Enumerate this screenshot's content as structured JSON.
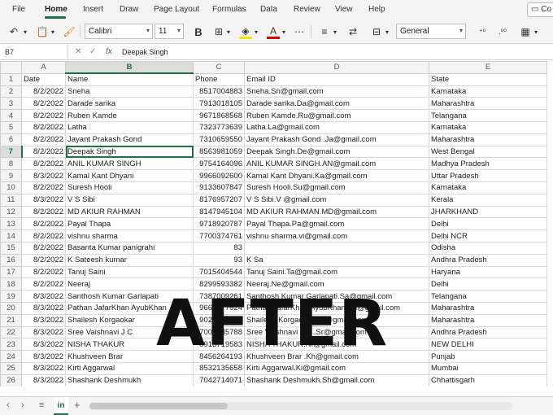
{
  "menu": {
    "tabs": [
      "File",
      "Home",
      "Insert",
      "Draw",
      "Page Layout",
      "Formulas",
      "Data",
      "Review",
      "View",
      "Help"
    ],
    "active": "Home",
    "comments_label": "Co"
  },
  "ribbon": {
    "font_name": "Calibri",
    "font_size": "11",
    "number_format": "General",
    "bold_label": "B",
    "font_color_label": "A"
  },
  "formula_bar": {
    "name_box": "B7",
    "fx_label": "fx",
    "content": "Deepak Singh"
  },
  "sheet": {
    "columns": [
      "A",
      "B",
      "C",
      "D",
      "E"
    ],
    "selected_column": "B",
    "selected_row": 7,
    "headers": [
      "Date",
      "Name",
      "Phone",
      "Email ID",
      "State"
    ],
    "rows": [
      [
        "8/2/2022",
        "Sneha",
        "8517004883",
        "Sneha.Sn@gmail.com",
        "Karnataka"
      ],
      [
        "8/2/2022",
        "Darade sarika",
        "7913018105",
        "Darade sarika.Da@gmail.com",
        "Maharashtra"
      ],
      [
        "8/2/2022",
        "Ruben Kamde",
        "9671868568",
        "Ruben Kamde.Ru@gmail.com",
        "Telangana"
      ],
      [
        "8/2/2022",
        "Latha",
        "7323773639",
        "Latha.La@gmail.com",
        "Karnataka"
      ],
      [
        "8/2/2022",
        "Jayant Prakash Gond",
        "7310659550",
        "Jayant Prakash Gond .Ja@gmail.com",
        "Maharashtra"
      ],
      [
        "8/2/2022",
        "Deepak Singh",
        "8563981059",
        "Deepak Singh.De@gmail.com",
        "West Bengal"
      ],
      [
        "8/2/2022",
        "ANIL KUMAR SINGH",
        "9754164096",
        "ANIL KUMAR SINGH.AN@gmail.com",
        "Madhya Pradesh"
      ],
      [
        "8/3/2022",
        "Kamal Kant Dhyani",
        "9966092600",
        "Kamal Kant Dhyani.Ka@gmail.com",
        "Uttar Pradesh"
      ],
      [
        "8/2/2022",
        "Suresh Hooli",
        "9133607847",
        "Suresh Hooli.Su@gmail.com",
        "Karnataka"
      ],
      [
        "8/3/2022",
        "V S Sibi",
        "8176957207",
        "V S Sibi.V @gmail.com",
        "Kerala"
      ],
      [
        "8/2/2022",
        "MD AKIUR RAHMAN",
        "8147945104",
        "MD AKIUR RAHMAN.MD@gmail.com",
        "JHARKHAND"
      ],
      [
        "8/2/2022",
        "Payal Thapa",
        "9718920787",
        "Payal Thapa.Pa@gmail.com",
        "Delhi"
      ],
      [
        "8/2/2022",
        "vishnu sharma",
        "7700374761",
        "vishnu sharma.vi@gmail.com",
        "Delhi NCR"
      ],
      [
        "8/2/2022",
        "Basanta Kumar panigrahi",
        "83",
        "",
        "Odisha"
      ],
      [
        "8/2/2022",
        "K Sateesh kumar",
        "93",
        "K Sa",
        "Andhra Pradesh"
      ],
      [
        "8/2/2022",
        "Tanuj Saini",
        "7015404544",
        "Tanuj Saini.Ta@gmail.com",
        "Haryana"
      ],
      [
        "8/2/2022",
        "Neeraj",
        "8299593382",
        "Neeraj.Ne@gmail.com",
        "Delhi"
      ],
      [
        "8/3/2022",
        "Santhosh Kumar Garlapati",
        "7387009261",
        "Santhosh Kumar Garlapati.Sa@gmail.com",
        "Telangana"
      ],
      [
        "8/3/2022",
        "Pathan JafarKhan AyubKhan",
        "9661777624",
        "Pathan JafarKhan AyubKhan.Pa@gmail.com",
        "Maharashtra"
      ],
      [
        "8/3/2022",
        "Shailesh Korgaokar",
        "9029535801",
        "Shailesh Korgaokar.Sh@gmail.com",
        "Maharashtra"
      ],
      [
        "8/3/2022",
        "Sree Vaishnavi J C",
        "7005585788",
        "Sree Vaishnavi J C .Sr@gmail.com",
        "Andhra Pradesh"
      ],
      [
        "8/3/2022",
        "NISHA THAKUR",
        "8913719583",
        "NISHA THAKUR.NI@gmail.com",
        "NEW DELHI"
      ],
      [
        "8/3/2022",
        "Khushveen Brar",
        "8456264193",
        "Khushveen Brar .Kh@gmail.com",
        "Punjab"
      ],
      [
        "8/3/2022",
        "Kirti Aggarwal",
        "8532135658",
        "Kirti Aggarwal.Ki@gmail.com",
        "Mumbai"
      ],
      [
        "8/3/2022",
        "Shashank Deshmukh",
        "7042714071",
        "Shashank Deshmukh.Sh@gmail.com",
        "Chhattisgarh"
      ]
    ]
  },
  "overlay_text": "AFTER",
  "sheet_tabs": {
    "tabs": [
      "in"
    ],
    "add_label": "+"
  }
}
